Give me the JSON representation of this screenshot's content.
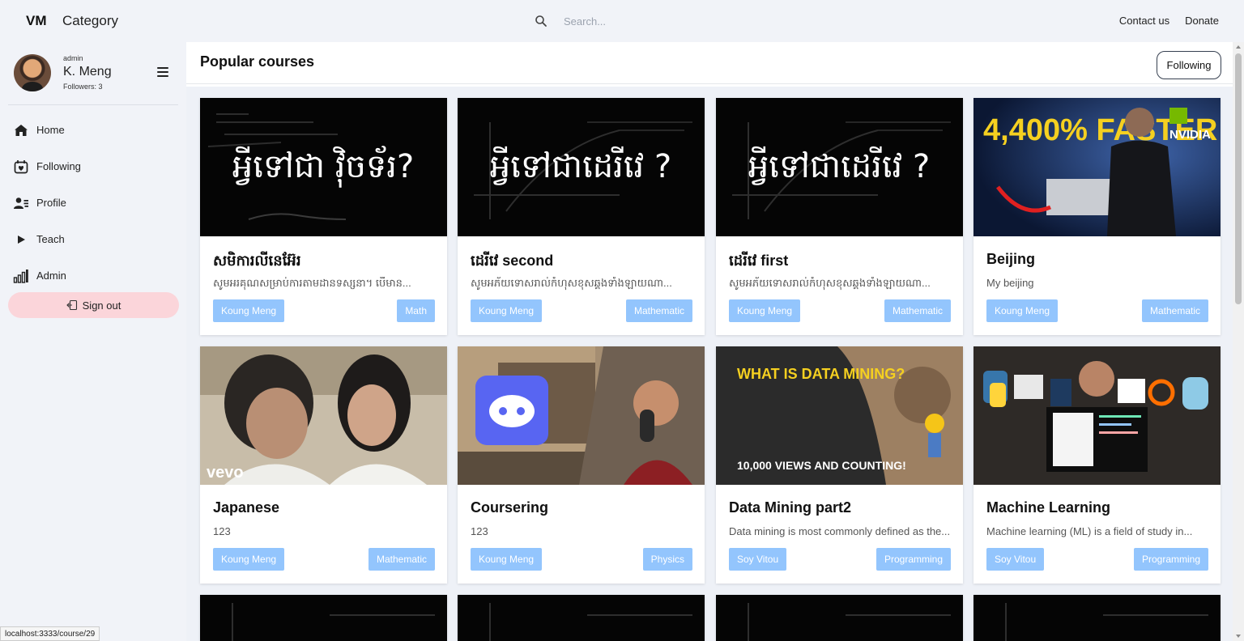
{
  "header": {
    "brand": "VM",
    "category": "Category",
    "search_placeholder": "Search...",
    "links": [
      "Contact us",
      "Donate"
    ]
  },
  "user": {
    "role": "admin",
    "name": "K. Meng",
    "followers": "Followers: 3"
  },
  "nav": [
    {
      "label": "Home",
      "icon": "home-icon"
    },
    {
      "label": "Following",
      "icon": "following-icon"
    },
    {
      "label": "Profile",
      "icon": "profile-icon"
    },
    {
      "label": "Teach",
      "icon": "play-icon"
    },
    {
      "label": "Admin",
      "icon": "chart-icon"
    }
  ],
  "signout": "Sign out",
  "section": {
    "title": "Popular courses",
    "following_button": "Following"
  },
  "courses": [
    {
      "title": "សមិការលីនេអ៊ែរ",
      "desc": "សូមអរគុណសម្រាប់ការតាមដានទស្សនា។ បើមាន...",
      "author": "Koung Meng",
      "category": "Math",
      "thumb_text": "អ្វីទៅជា វ៉ិចទ័រ?"
    },
    {
      "title": "ដេរីវេ second",
      "desc": "សូមអភ័យទោសរាល់កំហុសខុសឆ្គងទាំងឡាយណា...",
      "author": "Koung Meng",
      "category": "Mathematic",
      "thumb_text": "អ្វីទៅជាដេរីវេ ?"
    },
    {
      "title": "ដេរីវេ first",
      "desc": "សូមអភ័យទោសរាល់កំហុសខុសឆ្គងទាំងឡាយណា...",
      "author": "Koung Meng",
      "category": "Mathematic",
      "thumb_text": "អ្វីទៅជាដេរីវេ ?"
    },
    {
      "title": "Beijing",
      "desc": "My beijing",
      "author": "Koung Meng",
      "category": "Mathematic",
      "thumb_text": "4,400% FASTER",
      "thumb_brand": "NVIDIA"
    },
    {
      "title": "Japanese",
      "desc": "123",
      "author": "Koung Meng",
      "category": "Mathematic",
      "thumb_brand": "vevo"
    },
    {
      "title": "Coursering",
      "desc": "123",
      "author": "Koung Meng",
      "category": "Physics"
    },
    {
      "title": "Data Mining part2",
      "desc": "Data mining is most commonly defined as the...",
      "author": "Soy Vitou",
      "category": "Programming",
      "thumb_text": "WHAT IS DATA MINING?",
      "thumb_sub": "10,000 VIEWS AND COUNTING!"
    },
    {
      "title": "Machine Learning",
      "desc": "Machine learning (ML) is a field of study in...",
      "author": "Soy Vitou",
      "category": "Programming"
    }
  ],
  "status_url": "localhost:3333/course/29",
  "colors": {
    "tag": "#93c5fd",
    "signout_bg": "#fbd5da",
    "sidebar_bg": "#f1f3f8"
  }
}
